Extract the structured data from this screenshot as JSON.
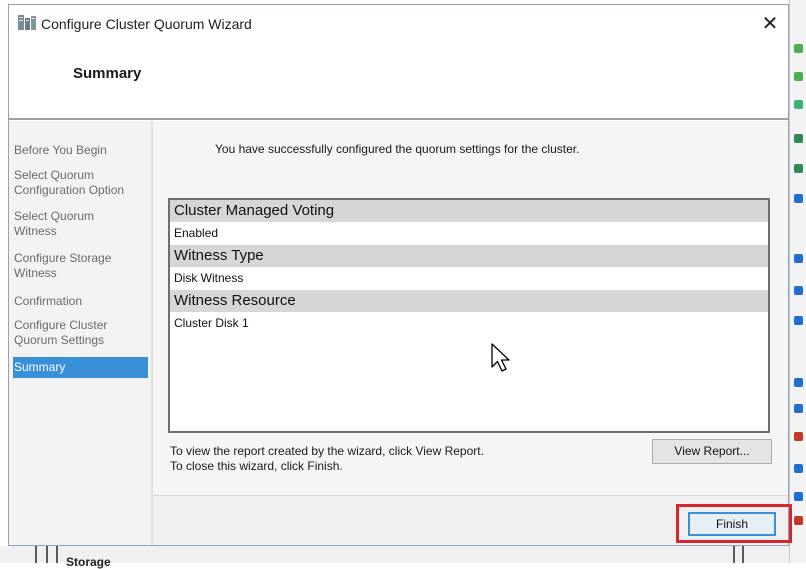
{
  "window": {
    "title": "Configure Cluster Quorum Wizard",
    "close_glyph": "✕",
    "page_heading": "Summary"
  },
  "nav": {
    "items": [
      {
        "line1": "Before You Begin",
        "line2": ""
      },
      {
        "line1": "Select Quorum",
        "line2": "Configuration Option"
      },
      {
        "line1": "Select Quorum",
        "line2": "Witness"
      },
      {
        "line1": "Configure Storage",
        "line2": "Witness"
      },
      {
        "line1": "Confirmation",
        "line2": ""
      },
      {
        "line1": "Configure Cluster",
        "line2": "Quorum Settings"
      },
      {
        "line1": "Summary",
        "line2": ""
      }
    ],
    "active_index": 6
  },
  "content": {
    "success_message": "You have successfully configured the quorum settings for the cluster.",
    "report": [
      {
        "heading": "Cluster Managed Voting",
        "value": "Enabled"
      },
      {
        "heading": "Witness Type",
        "value": "Disk Witness"
      },
      {
        "heading": "Witness Resource",
        "value": "Cluster Disk 1"
      }
    ],
    "hint_view": "To view the report created by the wizard, click View Report.",
    "hint_close": "To close this wizard, click Finish.",
    "view_report_label": "View Report..."
  },
  "footer": {
    "finish_label": "Finish",
    "highlight_color": "#d8262f"
  },
  "background": {
    "partial_text": "Storage"
  },
  "colors": {
    "accent": "#3a8fd9",
    "nav_bg": "#f3f3f3",
    "report_heading_bg": "#d6d6d6"
  }
}
